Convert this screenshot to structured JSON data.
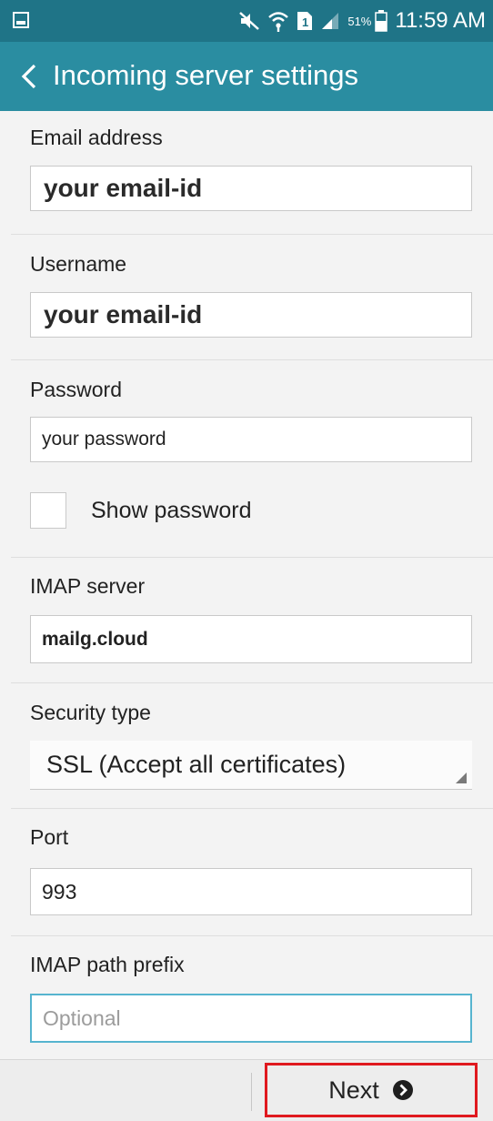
{
  "status_bar": {
    "time": "11:59 AM",
    "battery_percent": "51%",
    "icons": [
      "screenshot-icon",
      "mute-icon",
      "wifi-icon",
      "sim-icon",
      "signal-icon",
      "battery-icon"
    ]
  },
  "header": {
    "title": "Incoming server settings",
    "back_icon": "chevron-left-icon"
  },
  "form": {
    "email": {
      "label": "Email address",
      "value": "your email-id"
    },
    "username": {
      "label": "Username",
      "value": "your email-id"
    },
    "password": {
      "label": "Password",
      "value": "your password",
      "show_password_label": "Show password",
      "show_password_checked": false
    },
    "imap_server": {
      "label": "IMAP server",
      "value": "mailg.cloud"
    },
    "security_type": {
      "label": "Security type",
      "value": "SSL (Accept all certificates)"
    },
    "port": {
      "label": "Port",
      "value": "993"
    },
    "imap_path_prefix": {
      "label": "IMAP path prefix",
      "placeholder": "Optional",
      "value": ""
    }
  },
  "footer": {
    "next_label": "Next",
    "next_icon": "chevron-right-circle-icon",
    "highlight_color": "#e0191f"
  },
  "colors": {
    "status_bar": "#1f7487",
    "title_bar": "#2a8da1",
    "focus_border": "#56b4cf"
  }
}
